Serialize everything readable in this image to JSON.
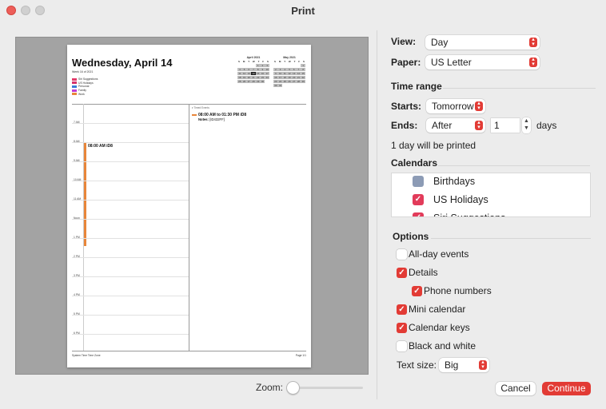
{
  "window": {
    "title": "Print"
  },
  "preview": {
    "page_title": "Wednesday, April 14",
    "week_label": "Week 16 of 2021",
    "calendar_keys": [
      {
        "label": "Siri Suggestions",
        "color": "#e23b6a"
      },
      {
        "label": "US Holidays",
        "color": "#d6336c"
      },
      {
        "label": "Personal",
        "color": "#3b7bd6"
      },
      {
        "label": "Family",
        "color": "#c03bd6"
      },
      {
        "label": "Work",
        "color": "#e8863a"
      }
    ],
    "mini_calendars": [
      {
        "month": "April 2021",
        "weekdays": [
          "S",
          "M",
          "T",
          "W",
          "T",
          "F",
          "S"
        ],
        "days": [
          "",
          "",
          "",
          "",
          "1",
          "2",
          "3",
          "4",
          "5",
          "6",
          "7",
          "8",
          "9",
          "10",
          "11",
          "12",
          "13",
          "14",
          "15",
          "16",
          "17",
          "18",
          "19",
          "20",
          "21",
          "22",
          "23",
          "24",
          "25",
          "26",
          "27",
          "28",
          "29",
          "30",
          ""
        ],
        "today": "14"
      },
      {
        "month": "May 2021",
        "weekdays": [
          "S",
          "M",
          "T",
          "W",
          "T",
          "F",
          "S"
        ],
        "days": [
          "",
          "",
          "",
          "",
          "",
          "",
          "1",
          "2",
          "3",
          "4",
          "5",
          "6",
          "7",
          "8",
          "9",
          "10",
          "11",
          "12",
          "13",
          "14",
          "15",
          "16",
          "17",
          "18",
          "19",
          "20",
          "21",
          "22",
          "23",
          "24",
          "25",
          "26",
          "27",
          "28",
          "29",
          "30",
          "31",
          "",
          "",
          "",
          "",
          "",
          ""
        ],
        "today": ""
      }
    ],
    "hours": [
      "7 AM",
      "8 AM",
      "9 AM",
      "10 AM",
      "11 AM",
      "Noon",
      "1 PM",
      "2 PM",
      "3 PM",
      "4 PM",
      "5 PM",
      "6 PM"
    ],
    "event_label": "08:00 AM iD8",
    "event_color": "#e8863a",
    "timed_events_label": "▾ Timed Events",
    "event_time": "08:00 AM to 01:30 PM iD8",
    "event_notes_label": "Notes:",
    "event_notes_value": "[ID432FF]",
    "footer_left": "System Time Time Zone",
    "footer_right": "Page 1/1"
  },
  "zoom": {
    "label": "Zoom:",
    "level": 0.0
  },
  "settings": {
    "view_label": "View:",
    "view_value": "Day",
    "paper_label": "Paper:",
    "paper_value": "US Letter",
    "time_range_heading": "Time range",
    "starts_label": "Starts:",
    "starts_value": "Tomorrow",
    "ends_label": "Ends:",
    "ends_value": "After",
    "ends_count": "1",
    "ends_unit": "days",
    "summary": "1 day will be printed",
    "calendars_heading": "Calendars",
    "calendars": [
      {
        "label": "Birthdays",
        "checked": false,
        "color": "#8c9bb5"
      },
      {
        "label": "US Holidays",
        "checked": true,
        "color": "#e23b5a"
      },
      {
        "label": "Siri Suggestions",
        "checked": true,
        "color": "#e23b5a"
      }
    ],
    "options_heading": "Options",
    "options": [
      {
        "label": "All-day events",
        "checked": false
      },
      {
        "label": "Details",
        "checked": true
      },
      {
        "label": "Phone numbers",
        "checked": true
      },
      {
        "label": "Mini calendar",
        "checked": true
      },
      {
        "label": "Calendar keys",
        "checked": true
      },
      {
        "label": "Black and white",
        "checked": false
      }
    ],
    "text_size_label": "Text size:",
    "text_size_value": "Big"
  },
  "buttons": {
    "cancel": "Cancel",
    "continue": "Continue"
  },
  "colors": {
    "accent": "#e23b35"
  }
}
